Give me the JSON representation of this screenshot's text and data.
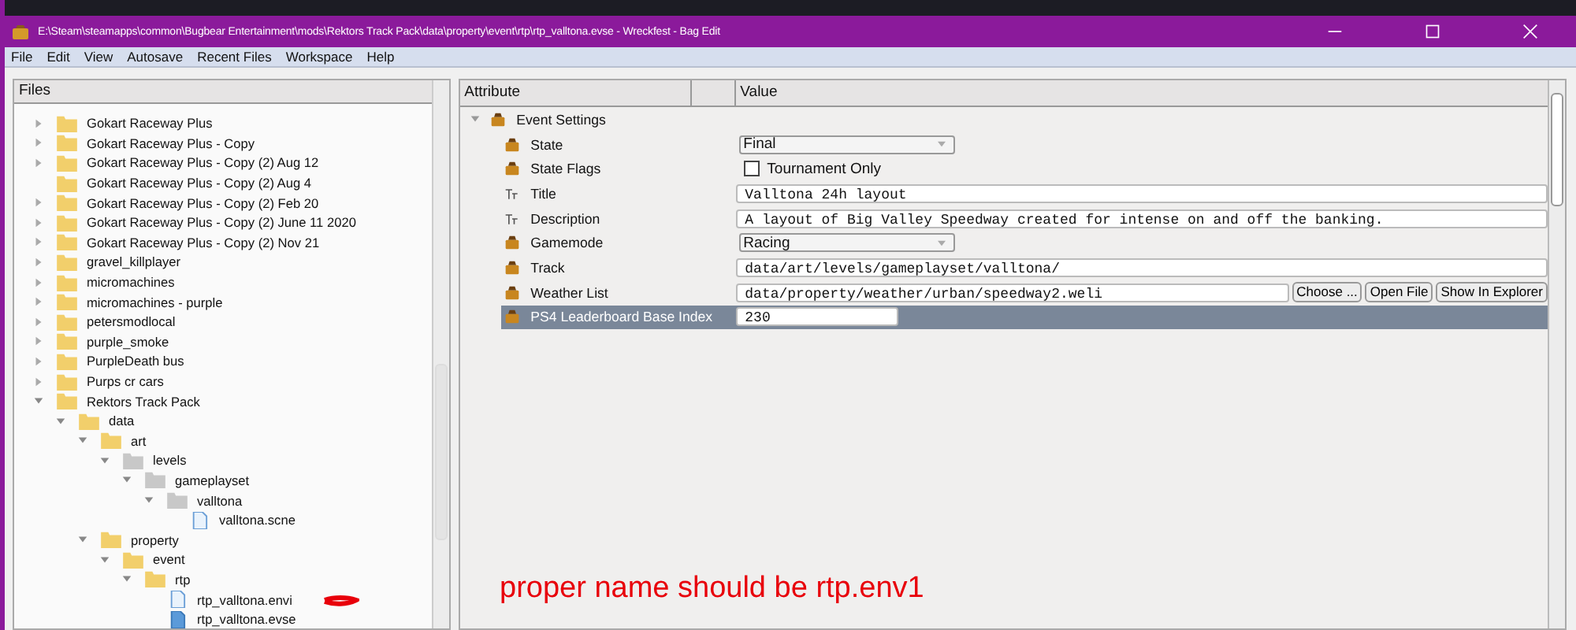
{
  "window": {
    "title": "E:\\Steam\\steamapps\\common\\Bugbear Entertainment\\mods\\Rektors Track Pack\\data\\property\\event\\rtp\\rtp_valltona.evse - Wreckfest - Bag Edit"
  },
  "menu": [
    "File",
    "Edit",
    "View",
    "Autosave",
    "Recent Files",
    "Workspace",
    "Help"
  ],
  "files": {
    "header": "Files",
    "tree": [
      {
        "label": "Gokart Raceway Plus",
        "kind": "folder",
        "expanded": false
      },
      {
        "label": "Gokart Raceway Plus - Copy",
        "kind": "folder",
        "expanded": false
      },
      {
        "label": "Gokart Raceway Plus - Copy (2) Aug 12",
        "kind": "folder",
        "expanded": false
      },
      {
        "label": "Gokart Raceway Plus - Copy (2) Aug 4",
        "kind": "folder"
      },
      {
        "label": "Gokart Raceway Plus - Copy (2) Feb 20",
        "kind": "folder",
        "expanded": false
      },
      {
        "label": "Gokart Raceway Plus - Copy (2) June 11 2020",
        "kind": "folder",
        "expanded": false
      },
      {
        "label": "Gokart Raceway Plus - Copy (2) Nov 21",
        "kind": "folder",
        "expanded": false
      },
      {
        "label": "gravel_killplayer",
        "kind": "folder",
        "expanded": false
      },
      {
        "label": "micromachines",
        "kind": "folder",
        "expanded": false
      },
      {
        "label": "micromachines - purple",
        "kind": "folder",
        "expanded": false
      },
      {
        "label": "petersmodlocal",
        "kind": "folder",
        "expanded": false
      },
      {
        "label": "purple_smoke",
        "kind": "folder",
        "expanded": false
      },
      {
        "label": "PurpleDeath bus",
        "kind": "folder",
        "expanded": false
      },
      {
        "label": "Purps cr cars",
        "kind": "folder",
        "expanded": false
      },
      {
        "label": "Rektors Track Pack",
        "kind": "folder",
        "expanded": true,
        "children": [
          {
            "label": "data",
            "kind": "folder",
            "expanded": true,
            "children": [
              {
                "label": "art",
                "kind": "folder",
                "expanded": true,
                "children": [
                  {
                    "label": "levels",
                    "kind": "grey-folder",
                    "expanded": true,
                    "children": [
                      {
                        "label": "gameplayset",
                        "kind": "grey-folder",
                        "expanded": true,
                        "children": [
                          {
                            "label": "valltona",
                            "kind": "grey-folder",
                            "expanded": true,
                            "children": [
                              {
                                "label": "valltona.scne",
                                "kind": "file"
                              }
                            ]
                          }
                        ]
                      }
                    ]
                  }
                ]
              },
              {
                "label": "property",
                "kind": "folder",
                "expanded": true,
                "children": [
                  {
                    "label": "event",
                    "kind": "folder",
                    "expanded": true,
                    "children": [
                      {
                        "label": "rtp",
                        "kind": "folder",
                        "expanded": true,
                        "children": [
                          {
                            "label": "rtp_valltona.envi",
                            "kind": "file"
                          },
                          {
                            "label": "rtp_valltona.evse",
                            "kind": "open-file"
                          }
                        ]
                      }
                    ]
                  }
                ]
              }
            ]
          }
        ]
      }
    ]
  },
  "properties": {
    "columns": [
      "Attribute",
      "Value"
    ],
    "group": "Event Settings",
    "group_expanded": true,
    "rows": [
      {
        "label": "State",
        "kind": "dropdown",
        "value": "Final",
        "selected": false
      },
      {
        "label": "State Flags",
        "kind": "checkbox",
        "option": "Tournament Only",
        "checked": false,
        "selected": false
      },
      {
        "label": "Title",
        "kind": "text",
        "value": "Valltona 24h layout",
        "selected": false
      },
      {
        "label": "Description",
        "kind": "text",
        "value": "A layout of Big Valley Speedway created for intense on and off the banking.",
        "selected": false
      },
      {
        "label": "Gamemode",
        "kind": "dropdown",
        "value": "Racing",
        "selected": false
      },
      {
        "label": "Track",
        "kind": "path",
        "value": "data/art/levels/gameplayset/valltona/",
        "selected": false
      },
      {
        "label": "Weather List",
        "kind": "file",
        "value": "data/property/weather/urban/speedway2.weli",
        "buttons": [
          "Choose ...",
          "Open File",
          "Show In Explorer"
        ],
        "selected": false
      },
      {
        "label": "PS4 Leaderboard Base Index",
        "kind": "number",
        "value": "230",
        "selected": true
      }
    ]
  },
  "annotation": "proper name should be rtp.env1"
}
